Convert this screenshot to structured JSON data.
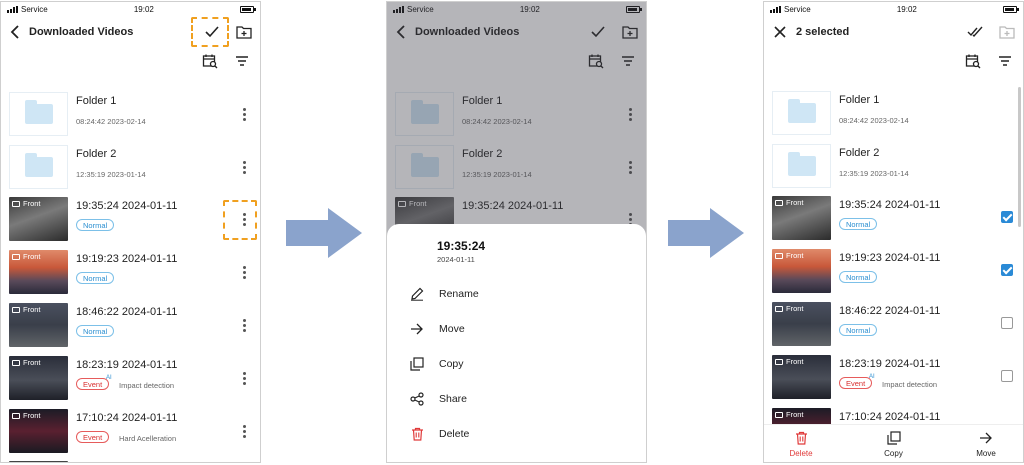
{
  "status": {
    "carrier": "Service",
    "time": "19:02"
  },
  "screen1": {
    "title": "Downloaded Videos",
    "items": [
      {
        "kind": "folder",
        "title": "Folder 1",
        "date": "08:24:42 2023-02-14"
      },
      {
        "kind": "folder",
        "title": "Folder 2",
        "date": "12:35:19 2023-01-14"
      },
      {
        "kind": "video",
        "label": "Front",
        "title": "19:35:24  2024-01-11",
        "badge": "Normal",
        "badge_type": "normal"
      },
      {
        "kind": "video",
        "label": "Front",
        "title": "19:19:23  2024-01-11",
        "badge": "Normal",
        "badge_type": "normal"
      },
      {
        "kind": "video",
        "label": "Front",
        "title": "18:46:22  2024-01-11",
        "badge": "Normal",
        "badge_type": "normal"
      },
      {
        "kind": "video",
        "label": "Front",
        "title": "18:23:19  2024-01-11",
        "badge": "Event",
        "badge_type": "event",
        "ai": "AI",
        "desc": "Impact detection"
      },
      {
        "kind": "video",
        "label": "Front",
        "title": "17:10:24  2024-01-11",
        "badge": "Event",
        "badge_type": "event",
        "desc": "Hard Acelleration"
      }
    ]
  },
  "screen2": {
    "title": "Downloaded Videos",
    "sheet": {
      "title": "19:35:24",
      "date": "2024-01-11",
      "actions": [
        "Rename",
        "Move",
        "Copy",
        "Share",
        "Delete"
      ]
    }
  },
  "screen3": {
    "title": "2 selected",
    "checked": [
      true,
      true,
      false,
      false,
      false
    ],
    "bottom": {
      "delete": "Delete",
      "copy": "Copy",
      "move": "Move"
    }
  },
  "colors": {
    "accent": "#2a8ad6",
    "highlight": "#f0a020",
    "arrow": "#8aa3cc",
    "danger": "#e03a3a"
  }
}
